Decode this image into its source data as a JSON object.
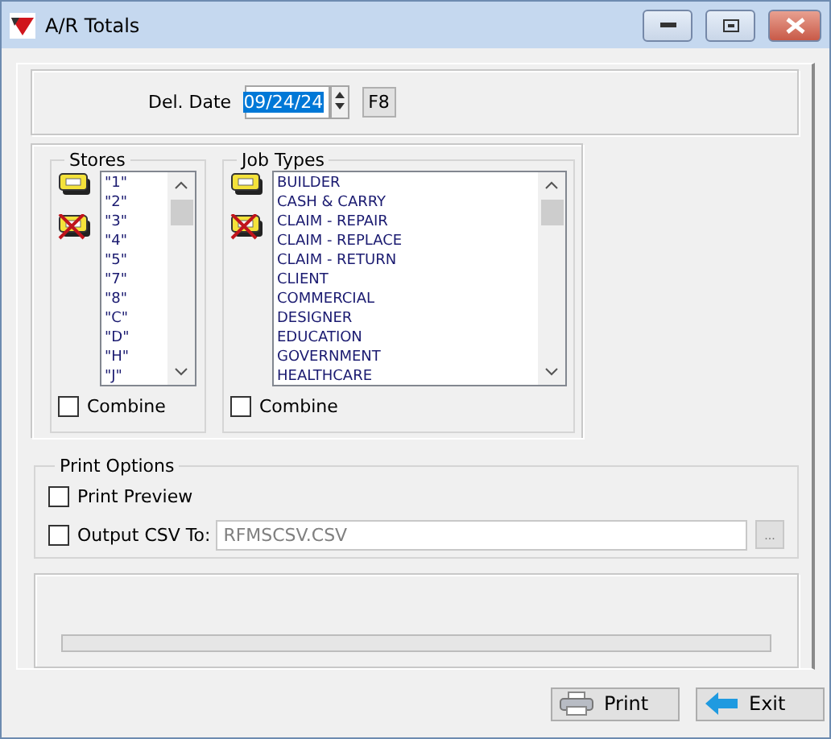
{
  "window": {
    "title": "A/R Totals"
  },
  "del_date": {
    "label": "Del. Date",
    "value": "09/24/24",
    "lookup_button": "F8"
  },
  "stores": {
    "title": "Stores",
    "items": [
      {
        "label": "\"1\"",
        "selected": false
      },
      {
        "label": "\"2\"",
        "selected": false
      },
      {
        "label": "\"3\"",
        "selected": false
      },
      {
        "label": "\"4\"",
        "selected": false
      },
      {
        "label": "\"5\"",
        "selected": false
      },
      {
        "label": "\"7\"",
        "selected": false
      },
      {
        "label": "\"8\"",
        "selected": false
      },
      {
        "label": "\"C\"",
        "selected": false
      },
      {
        "label": "\"D\"",
        "selected": false
      },
      {
        "label": "\"H\"",
        "selected": false
      },
      {
        "label": "\"J\"",
        "selected": false
      }
    ],
    "combine": {
      "label": "Combine",
      "checked": false
    }
  },
  "job_types": {
    "title": "Job Types",
    "items": [
      {
        "label": "BUILDER",
        "selected": false
      },
      {
        "label": "CASH & CARRY",
        "selected": false
      },
      {
        "label": "CLAIM - REPAIR",
        "selected": false
      },
      {
        "label": "CLAIM - REPLACE",
        "selected": false
      },
      {
        "label": "CLAIM - RETURN",
        "selected": false
      },
      {
        "label": "CLIENT",
        "selected": false
      },
      {
        "label": "COMMERCIAL",
        "selected": false
      },
      {
        "label": "DESIGNER",
        "selected": false
      },
      {
        "label": "EDUCATION",
        "selected": false
      },
      {
        "label": "GOVERNMENT",
        "selected": false
      },
      {
        "label": "HEALTHCARE",
        "selected": false
      }
    ],
    "combine": {
      "label": "Combine",
      "checked": false
    }
  },
  "print_options": {
    "title": "Print Options",
    "print_preview": {
      "label": "Print Preview",
      "checked": false
    },
    "output_csv": {
      "label": "Output CSV To:",
      "checked": false,
      "value": "RFMSCSV.CSV",
      "browse_button": "..."
    }
  },
  "progress": {
    "level": 0
  },
  "buttons": [
    {
      "kind": "print",
      "label": "Print"
    },
    {
      "kind": "exit",
      "label": "Exit"
    }
  ]
}
